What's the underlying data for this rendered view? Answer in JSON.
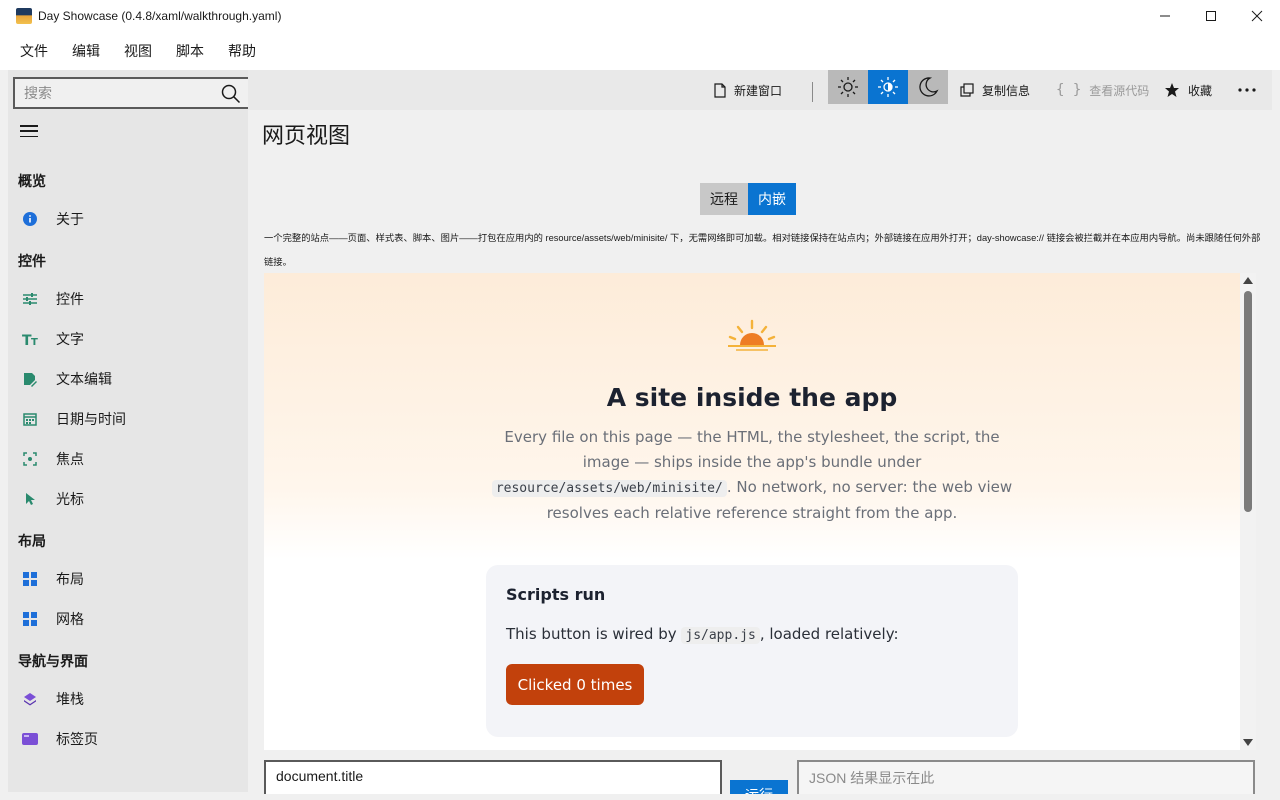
{
  "window": {
    "title": "Day Showcase (0.4.8/xaml/walkthrough.yaml)"
  },
  "menu": [
    "文件",
    "编辑",
    "视图",
    "脚本",
    "帮助"
  ],
  "search": {
    "placeholder": "搜索"
  },
  "sidebar": {
    "sections": [
      {
        "title": "概览",
        "items": [
          {
            "label": "关于",
            "icon": "info-icon"
          }
        ]
      },
      {
        "title": "控件",
        "items": [
          {
            "label": "控件",
            "icon": "sliders-icon"
          },
          {
            "label": "文字",
            "icon": "text-icon"
          },
          {
            "label": "文本编辑",
            "icon": "edit-icon"
          },
          {
            "label": "日期与时间",
            "icon": "calendar-icon"
          },
          {
            "label": "焦点",
            "icon": "focus-icon"
          },
          {
            "label": "光标",
            "icon": "cursor-icon"
          }
        ]
      },
      {
        "title": "布局",
        "items": [
          {
            "label": "布局",
            "icon": "layout-icon"
          },
          {
            "label": "网格",
            "icon": "grid-icon"
          }
        ]
      },
      {
        "title": "导航与界面",
        "items": [
          {
            "label": "堆栈",
            "icon": "stack-icon"
          },
          {
            "label": "标签页",
            "icon": "tabs-icon"
          }
        ]
      }
    ]
  },
  "toolbar": {
    "new_window": "新建窗口",
    "copy_info": "复制信息",
    "view_source": "查看源代码",
    "favorite": "收藏",
    "theme_options": [
      "light",
      "auto",
      "dark"
    ],
    "theme_selected": "auto"
  },
  "main": {
    "title": "网页视图",
    "tabs": [
      "远程",
      "内嵌"
    ],
    "selected_tab": "内嵌",
    "description": "一个完整的站点——页面、样式表、脚本、图片——打包在应用内的 resource/assets/web/minisite/ 下，无需网络即可加载。相对链接保持在站点内；外部链接在应用外打开；day-showcase:// 链接会被拦截并在本应用内导航。尚未跟随任何外部链接。"
  },
  "webview": {
    "heading": "A site inside the app",
    "lede_1": "Every file on this page — the HTML, the stylesheet, the script, the image — ships inside the app's bundle under ",
    "lede_code": "resource/assets/web/minisite/",
    "lede_2": ". No network, no server: the web view resolves each relative reference straight from the app.",
    "card_title": "Scripts run",
    "card_text_1": "This button is wired by ",
    "card_code": "js/app.js",
    "card_text_2": ", loaded relatively:",
    "button_label": "Clicked 0 times",
    "scroll_position": 0.0
  },
  "bottom": {
    "eval_value": "document.title",
    "run_label": "运行",
    "result_placeholder": "JSON 结果显示在此"
  },
  "colors": {
    "accent": "#0a74d1",
    "site_button": "#c2410c",
    "icon_teal": "#2a8a6e",
    "icon_blue": "#1e6fd9",
    "icon_purple": "#7b4fd6"
  }
}
